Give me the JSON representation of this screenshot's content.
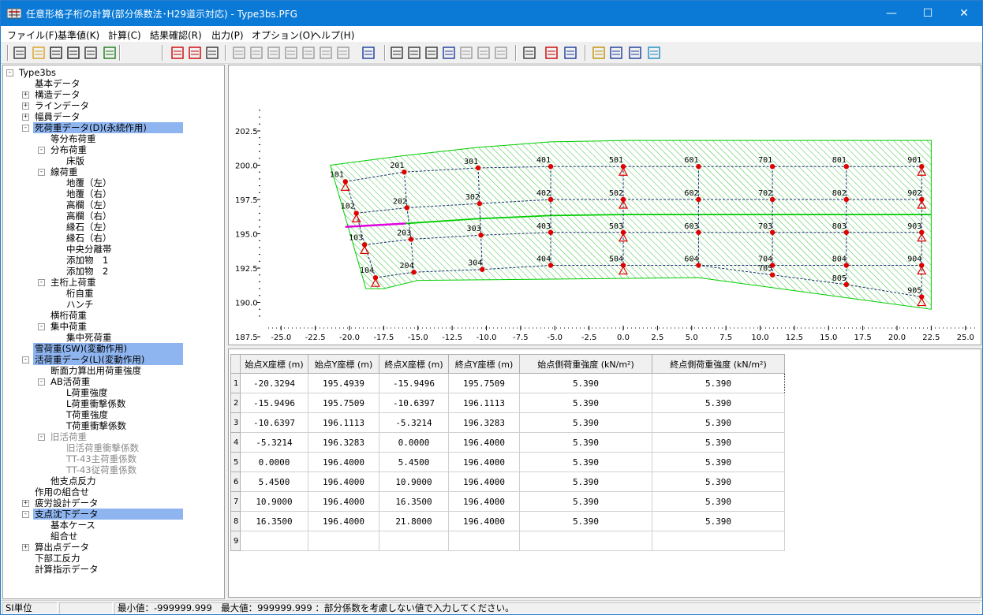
{
  "window": {
    "title": "任意形格子桁の計算(部分係数法･H29道示対応) - Type3bs.PFG",
    "minimize_glyph": "—",
    "maximize_glyph": "☐",
    "close_glyph": "✕"
  },
  "menu": [
    "ファイル(F)",
    "基準値(K)",
    "計算(C)",
    "結果確認(R)",
    "出力(P)",
    "オプション(O)",
    "ヘルプ(H)"
  ],
  "toolbar_icons": [
    "new-file-icon",
    "open-folder-icon",
    "save-icon",
    "save-as-icon",
    "delete-icon",
    "export-icon",
    "node-edit-icon",
    "member-edit-icon",
    "table-icon",
    "view1-icon",
    "view2-icon",
    "view3-icon",
    "view4-icon",
    "view5-icon",
    "view6-icon",
    "view7-icon",
    "3d-view-icon",
    "print-icon",
    "print-preview-icon",
    "print-setup-icon",
    "report1-icon",
    "report2-icon",
    "report3-icon",
    "report4-icon",
    "check-icon",
    "calc-icon",
    "result-icon",
    "help-icon",
    "book-icon",
    "info-icon",
    "grid-icon"
  ],
  "tree": [
    {
      "label": "Type3bs",
      "level": 0,
      "box": "-"
    },
    {
      "label": "基本データ",
      "level": 1
    },
    {
      "label": "構造データ",
      "level": 1,
      "box": "+"
    },
    {
      "label": "ラインデータ",
      "level": 1,
      "box": "+"
    },
    {
      "label": "幅員データ",
      "level": 1,
      "box": "+"
    },
    {
      "label": "死荷重データ(D)(永続作用)",
      "level": 1,
      "box": "-",
      "selected": true
    },
    {
      "label": "等分布荷重",
      "level": 2
    },
    {
      "label": "分布荷重",
      "level": 2,
      "box": "-"
    },
    {
      "label": "床版",
      "level": 3
    },
    {
      "label": "線荷重",
      "level": 2,
      "box": "-"
    },
    {
      "label": "地覆（左）",
      "level": 3
    },
    {
      "label": "地覆（右）",
      "level": 3
    },
    {
      "label": "高欄（左）",
      "level": 3
    },
    {
      "label": "高欄（右）",
      "level": 3
    },
    {
      "label": "縁石（左）",
      "level": 3
    },
    {
      "label": "縁石（右）",
      "level": 3
    },
    {
      "label": "中央分離帯",
      "level": 3
    },
    {
      "label": "添加物　1",
      "level": 3
    },
    {
      "label": "添加物　2",
      "level": 3
    },
    {
      "label": "主桁上荷重",
      "level": 2,
      "box": "-"
    },
    {
      "label": "桁自重",
      "level": 3
    },
    {
      "label": "ハンチ",
      "level": 3
    },
    {
      "label": "横桁荷重",
      "level": 2
    },
    {
      "label": "集中荷重",
      "level": 2,
      "box": "-"
    },
    {
      "label": "集中死荷重",
      "level": 3
    },
    {
      "label": "雪荷重(SW)(変動作用)",
      "level": 1,
      "selected": true
    },
    {
      "label": "活荷重データ(L)(変動作用)",
      "level": 1,
      "box": "-",
      "selected": true
    },
    {
      "label": "断面力算出用荷重強度",
      "level": 2
    },
    {
      "label": "AB活荷重",
      "level": 2,
      "box": "-"
    },
    {
      "label": "L荷重強度",
      "level": 3
    },
    {
      "label": "L荷重衝撃係数",
      "level": 3
    },
    {
      "label": "T荷重強度",
      "level": 3
    },
    {
      "label": "T荷重衝撃係数",
      "level": 3
    },
    {
      "label": "旧活荷重",
      "level": 2,
      "box": "-",
      "disabled": true
    },
    {
      "label": "旧活荷重衝撃係数",
      "level": 3,
      "disabled": true
    },
    {
      "label": "TT-43主荷重係数",
      "level": 3,
      "disabled": true
    },
    {
      "label": "TT-43従荷重係数",
      "level": 3,
      "disabled": true
    },
    {
      "label": "他支点反力",
      "level": 2
    },
    {
      "label": "作用の組合せ",
      "level": 1
    },
    {
      "label": "疲労設計データ",
      "level": 1,
      "box": "+"
    },
    {
      "label": "支点沈下データ",
      "level": 1,
      "box": "-",
      "selected": true
    },
    {
      "label": "基本ケース",
      "level": 2
    },
    {
      "label": "組合せ",
      "level": 2
    },
    {
      "label": "算出点データ",
      "level": 1,
      "box": "+"
    },
    {
      "label": "下部工反力",
      "level": 1
    },
    {
      "label": "計算指示データ",
      "level": 1
    }
  ],
  "plot": {
    "y_ticks": [
      "202.5",
      "200.0",
      "197.5",
      "195.0",
      "192.5",
      "190.0",
      "187.5"
    ],
    "x_ticks": [
      "-25.0",
      "-22.5",
      "-20.0",
      "-17.5",
      "-15.0",
      "-12.5",
      "-10.0",
      "-7.5",
      "-5.0",
      "-2.5",
      "0.0",
      "2.5",
      "5.0",
      "7.5",
      "10.0",
      "12.5",
      "15.0",
      "17.5",
      "20.0",
      "22.5",
      "25.0"
    ],
    "colors": {
      "hatch": "#3cc43c",
      "outline": "#00cc00",
      "girder": "#1a2e6e",
      "node": "#e00000",
      "support": "#e00000",
      "selected_load": "#e000e0"
    },
    "nodes": [
      {
        "id": "101",
        "x": -20.3,
        "y": 198.8
      },
      {
        "id": "102",
        "x": -19.5,
        "y": 196.5
      },
      {
        "id": "103",
        "x": -18.9,
        "y": 194.2
      },
      {
        "id": "104",
        "x": -18.1,
        "y": 191.8
      },
      {
        "id": "201",
        "x": -16.0,
        "y": 199.5
      },
      {
        "id": "202",
        "x": -15.8,
        "y": 196.9
      },
      {
        "id": "203",
        "x": -15.5,
        "y": 194.6
      },
      {
        "id": "204",
        "x": -15.3,
        "y": 192.2
      },
      {
        "id": "301",
        "x": -10.6,
        "y": 199.8
      },
      {
        "id": "302",
        "x": -10.5,
        "y": 197.2
      },
      {
        "id": "303",
        "x": -10.4,
        "y": 194.9
      },
      {
        "id": "304",
        "x": -10.3,
        "y": 192.4
      },
      {
        "id": "401",
        "x": -5.3,
        "y": 199.9
      },
      {
        "id": "402",
        "x": -5.3,
        "y": 197.5
      },
      {
        "id": "403",
        "x": -5.3,
        "y": 195.1
      },
      {
        "id": "404",
        "x": -5.3,
        "y": 192.7
      },
      {
        "id": "501",
        "x": 0.0,
        "y": 199.9
      },
      {
        "id": "502",
        "x": 0.0,
        "y": 197.5
      },
      {
        "id": "503",
        "x": 0.0,
        "y": 195.1
      },
      {
        "id": "504",
        "x": 0.0,
        "y": 192.7
      },
      {
        "id": "601",
        "x": 5.5,
        "y": 199.9
      },
      {
        "id": "602",
        "x": 5.5,
        "y": 197.5
      },
      {
        "id": "603",
        "x": 5.5,
        "y": 195.1
      },
      {
        "id": "604",
        "x": 5.5,
        "y": 192.7
      },
      {
        "id": "701",
        "x": 10.9,
        "y": 199.9
      },
      {
        "id": "702",
        "x": 10.9,
        "y": 197.5
      },
      {
        "id": "703",
        "x": 10.9,
        "y": 195.1
      },
      {
        "id": "704",
        "x": 10.9,
        "y": 192.7
      },
      {
        "id": "801",
        "x": 16.3,
        "y": 199.9
      },
      {
        "id": "802",
        "x": 16.3,
        "y": 197.5
      },
      {
        "id": "803",
        "x": 16.3,
        "y": 195.1
      },
      {
        "id": "804",
        "x": 16.3,
        "y": 192.7
      },
      {
        "id": "901",
        "x": 21.8,
        "y": 199.9
      },
      {
        "id": "902",
        "x": 21.8,
        "y": 197.5
      },
      {
        "id": "903",
        "x": 21.8,
        "y": 195.1
      },
      {
        "id": "904",
        "x": 21.8,
        "y": 192.7
      },
      {
        "id": "705",
        "x": 10.9,
        "y": 192.0
      },
      {
        "id": "805",
        "x": 16.3,
        "y": 191.3
      },
      {
        "id": "905",
        "x": 21.8,
        "y": 190.4
      }
    ]
  },
  "grid": {
    "headers": [
      "",
      "始点X座標 (m)",
      "始点Y座標 (m)",
      "終点X座標 (m)",
      "終点Y座標 (m)",
      "始点側荷重強度 (kN/m²)",
      "終点側荷重強度 (kN/m²)"
    ],
    "rows": [
      [
        "1",
        "-20.3294",
        "195.4939",
        "-15.9496",
        "195.7509",
        "5.390",
        "5.390"
      ],
      [
        "2",
        "-15.9496",
        "195.7509",
        "-10.6397",
        "196.1113",
        "5.390",
        "5.390"
      ],
      [
        "3",
        "-10.6397",
        "196.1113",
        "-5.3214",
        "196.3283",
        "5.390",
        "5.390"
      ],
      [
        "4",
        "-5.3214",
        "196.3283",
        "0.0000",
        "196.4000",
        "5.390",
        "5.390"
      ],
      [
        "5",
        "0.0000",
        "196.4000",
        "5.4500",
        "196.4000",
        "5.390",
        "5.390"
      ],
      [
        "6",
        "5.4500",
        "196.4000",
        "10.9000",
        "196.4000",
        "5.390",
        "5.390"
      ],
      [
        "7",
        "10.9000",
        "196.4000",
        "16.3500",
        "196.4000",
        "5.390",
        "5.390"
      ],
      [
        "8",
        "16.3500",
        "196.4000",
        "21.8000",
        "196.4000",
        "5.390",
        "5.390"
      ],
      [
        "9",
        "",
        "",
        "",
        "",
        "",
        ""
      ]
    ]
  },
  "status": {
    "unit": "SI単位",
    "blank": "",
    "message": "最小値：-999999.999　最大値：999999.999 ：部分係数を考慮しない値で入力してください。"
  }
}
